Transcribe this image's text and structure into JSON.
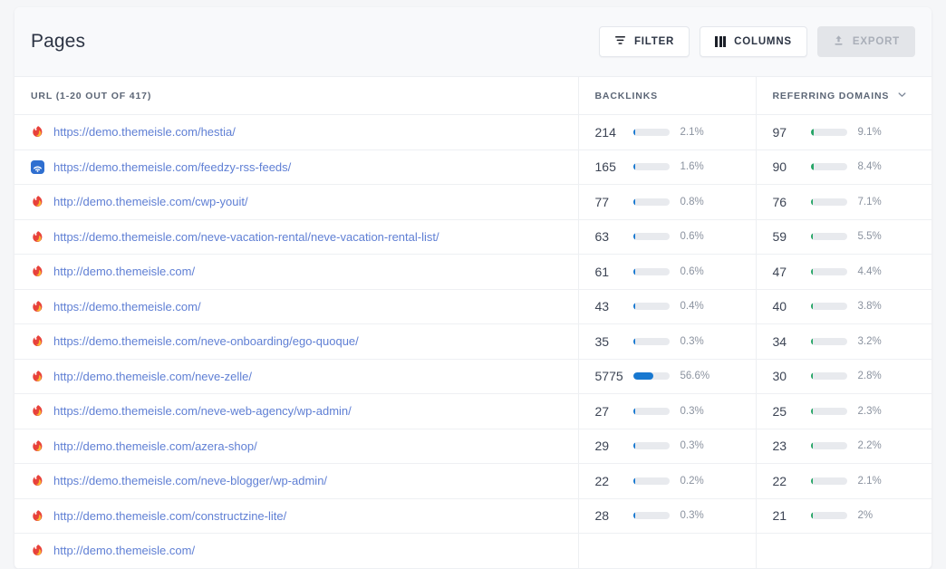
{
  "header": {
    "title": "Pages",
    "buttons": [
      {
        "label": "FILTER",
        "icon": "filter-icon",
        "disabled": false
      },
      {
        "label": "COLUMNS",
        "icon": "columns-icon",
        "disabled": false
      },
      {
        "label": "EXPORT",
        "icon": "export-icon",
        "disabled": true
      }
    ]
  },
  "table": {
    "columns": [
      {
        "key": "url",
        "label": "URL (1-20 OUT OF 417)",
        "sorted": false
      },
      {
        "key": "backlinks",
        "label": "BACKLINKS",
        "sorted": false
      },
      {
        "key": "referring_domains",
        "label": "REFERRING DOMAINS",
        "sorted": true,
        "sort_dir": "desc",
        "sort_icon": "chevron-down-icon"
      }
    ],
    "colors": {
      "backlinks_bar": "#1878d0",
      "referring_bar": "#27a567",
      "bar_track": "#e8eaee",
      "link": "#5f7fd4"
    },
    "rows": [
      {
        "favicon": "themeisle-flame-favicon",
        "url": "https://demo.themeisle.com/hestia/",
        "backlinks": "214",
        "backlinks_pct": "2.1%",
        "backlinks_bar": 3.7,
        "referring": "97",
        "referring_pct": "9.1%",
        "referring_bar": 9.1
      },
      {
        "favicon": "feedzy-rss-favicon",
        "url": "https://demo.themeisle.com/feedzy-rss-feeds/",
        "backlinks": "165",
        "backlinks_pct": "1.6%",
        "backlinks_bar": 2.8,
        "referring": "90",
        "referring_pct": "8.4%",
        "referring_bar": 8.4
      },
      {
        "favicon": "themeisle-flame-favicon",
        "url": "http://demo.themeisle.com/cwp-youit/",
        "backlinks": "77",
        "backlinks_pct": "0.8%",
        "backlinks_bar": 1.4,
        "referring": "76",
        "referring_pct": "7.1%",
        "referring_bar": 7.1
      },
      {
        "favicon": "themeisle-flame-favicon",
        "url": "https://demo.themeisle.com/neve-vacation-rental/neve-vacation-rental-list/",
        "backlinks": "63",
        "backlinks_pct": "0.6%",
        "backlinks_bar": 1.1,
        "referring": "59",
        "referring_pct": "5.5%",
        "referring_bar": 5.5
      },
      {
        "favicon": "themeisle-flame-favicon",
        "url": "http://demo.themeisle.com/",
        "backlinks": "61",
        "backlinks_pct": "0.6%",
        "backlinks_bar": 1.1,
        "referring": "47",
        "referring_pct": "4.4%",
        "referring_bar": 4.4
      },
      {
        "favicon": "themeisle-flame-favicon",
        "url": "https://demo.themeisle.com/",
        "backlinks": "43",
        "backlinks_pct": "0.4%",
        "backlinks_bar": 0.8,
        "referring": "40",
        "referring_pct": "3.8%",
        "referring_bar": 3.8
      },
      {
        "favicon": "themeisle-flame-favicon",
        "url": "https://demo.themeisle.com/neve-onboarding/ego-quoque/",
        "backlinks": "35",
        "backlinks_pct": "0.3%",
        "backlinks_bar": 0.6,
        "referring": "34",
        "referring_pct": "3.2%",
        "referring_bar": 3.2
      },
      {
        "favicon": "themeisle-flame-favicon",
        "url": "http://demo.themeisle.com/neve-zelle/",
        "backlinks": "5775",
        "backlinks_pct": "56.6%",
        "backlinks_bar": 56.6,
        "referring": "30",
        "referring_pct": "2.8%",
        "referring_bar": 2.8
      },
      {
        "favicon": "themeisle-flame-favicon",
        "url": "https://demo.themeisle.com/neve-web-agency/wp-admin/",
        "backlinks": "27",
        "backlinks_pct": "0.3%",
        "backlinks_bar": 0.5,
        "referring": "25",
        "referring_pct": "2.3%",
        "referring_bar": 2.3
      },
      {
        "favicon": "themeisle-flame-favicon",
        "url": "http://demo.themeisle.com/azera-shop/",
        "backlinks": "29",
        "backlinks_pct": "0.3%",
        "backlinks_bar": 0.5,
        "referring": "23",
        "referring_pct": "2.2%",
        "referring_bar": 2.2
      },
      {
        "favicon": "themeisle-flame-favicon",
        "url": "https://demo.themeisle.com/neve-blogger/wp-admin/",
        "backlinks": "22",
        "backlinks_pct": "0.2%",
        "backlinks_bar": 0.35,
        "referring": "22",
        "referring_pct": "2.1%",
        "referring_bar": 2.1
      },
      {
        "favicon": "themeisle-flame-favicon",
        "url": "http://demo.themeisle.com/constructzine-lite/",
        "backlinks": "28",
        "backlinks_pct": "0.3%",
        "backlinks_bar": 0.5,
        "referring": "21",
        "referring_pct": "2%",
        "referring_bar": 2.0
      },
      {
        "favicon": "themeisle-flame-favicon",
        "url": "http://demo.themeisle.com/",
        "backlinks": "",
        "backlinks_pct": "",
        "backlinks_bar": 0,
        "referring": "",
        "referring_pct": "",
        "referring_bar": 0
      }
    ]
  }
}
